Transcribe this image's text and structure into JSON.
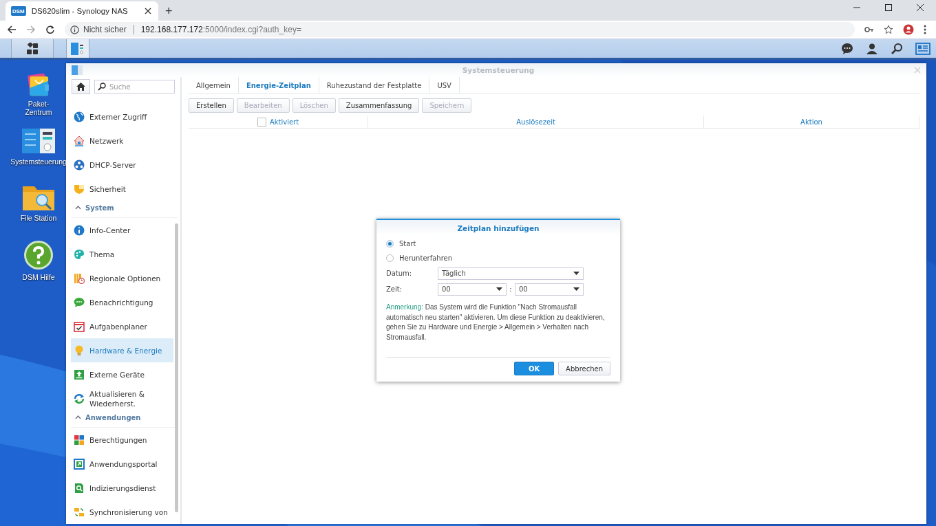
{
  "browser": {
    "tab_title": "DS620slim - Synology NAS",
    "tab_badge": "DSM",
    "new_tab": "+",
    "security": "Nicht sicher",
    "url_host": "192.168.177.172",
    "url_rest": ":5000/index.cgi?auth_key="
  },
  "desktop_icons": [
    {
      "label": "Paket-\nZentrum"
    },
    {
      "label": "Systemsteuerung"
    },
    {
      "label": "File Station"
    },
    {
      "label": "DSM Hilfe"
    }
  ],
  "window": {
    "title": "Systemsteuerung",
    "search": {
      "placeholder": "Suche"
    }
  },
  "sidebar": {
    "items": [
      {
        "kind": "item",
        "label": "Externer Zugriff",
        "selected": false
      },
      {
        "kind": "item",
        "label": "Netzwerk",
        "selected": false
      },
      {
        "kind": "item",
        "label": "DHCP-Server",
        "selected": false
      },
      {
        "kind": "item",
        "label": "Sicherheit",
        "selected": false
      },
      {
        "kind": "section",
        "label": "System"
      },
      {
        "kind": "item",
        "label": "Info-Center",
        "selected": false
      },
      {
        "kind": "item",
        "label": "Thema",
        "selected": false
      },
      {
        "kind": "item",
        "label": "Regionale Optionen",
        "selected": false
      },
      {
        "kind": "item",
        "label": "Benachrichtigung",
        "selected": false
      },
      {
        "kind": "item",
        "label": "Aufgabenplaner",
        "selected": false
      },
      {
        "kind": "item",
        "label": "Hardware & Energie",
        "selected": true
      },
      {
        "kind": "item",
        "label": "Externe Geräte",
        "selected": false
      },
      {
        "kind": "item",
        "label": "Aktualisieren & Wiederherst.",
        "selected": false
      },
      {
        "kind": "section",
        "label": "Anwendungen"
      },
      {
        "kind": "item",
        "label": "Berechtigungen",
        "selected": false
      },
      {
        "kind": "item",
        "label": "Anwendungsportal",
        "selected": false
      },
      {
        "kind": "item",
        "label": "Indizierungsdienst",
        "selected": false
      },
      {
        "kind": "item",
        "label": "Synchronisierung von",
        "selected": false
      }
    ]
  },
  "tabs": [
    {
      "label": "Allgemein",
      "selected": false
    },
    {
      "label": "Energie-Zeitplan",
      "selected": true
    },
    {
      "label": "Ruhezustand der Festplatte",
      "selected": false
    },
    {
      "label": "USV",
      "selected": false
    }
  ],
  "toolbar": [
    {
      "label": "Erstellen",
      "disabled": false
    },
    {
      "label": "Bearbeiten",
      "disabled": true
    },
    {
      "label": "Löschen",
      "disabled": true
    },
    {
      "label": "Zusammenfassung",
      "disabled": false
    },
    {
      "label": "Speichern",
      "disabled": true
    }
  ],
  "table": {
    "select_all_checked": false,
    "columns": [
      "Aktiviert",
      "Auslösezeit",
      "Aktion"
    ]
  },
  "dialog": {
    "title": "Zeitplan hinzufügen",
    "options": [
      {
        "label": "Start",
        "selected": true
      },
      {
        "label": "Herunterfahren",
        "selected": false
      }
    ],
    "date_label": "Datum:",
    "date_value": "Täglich",
    "time_label": "Zeit:",
    "hour_value": "00",
    "time_separator": ":",
    "minute_value": "00",
    "note_label": "Anmerkung:",
    "note_text": "Das System wird die Funktion \"Nach Stromausfall automatisch neu starten\" aktivieren. Um diese Funktion zu deaktivieren, gehen Sie zu Hardware und Energie > Allgemein > Verhalten nach Stromausfall.",
    "buttons": [
      {
        "label": "OK",
        "kind": "primary"
      },
      {
        "label": "Abbrechen",
        "kind": "secondary"
      }
    ]
  }
}
